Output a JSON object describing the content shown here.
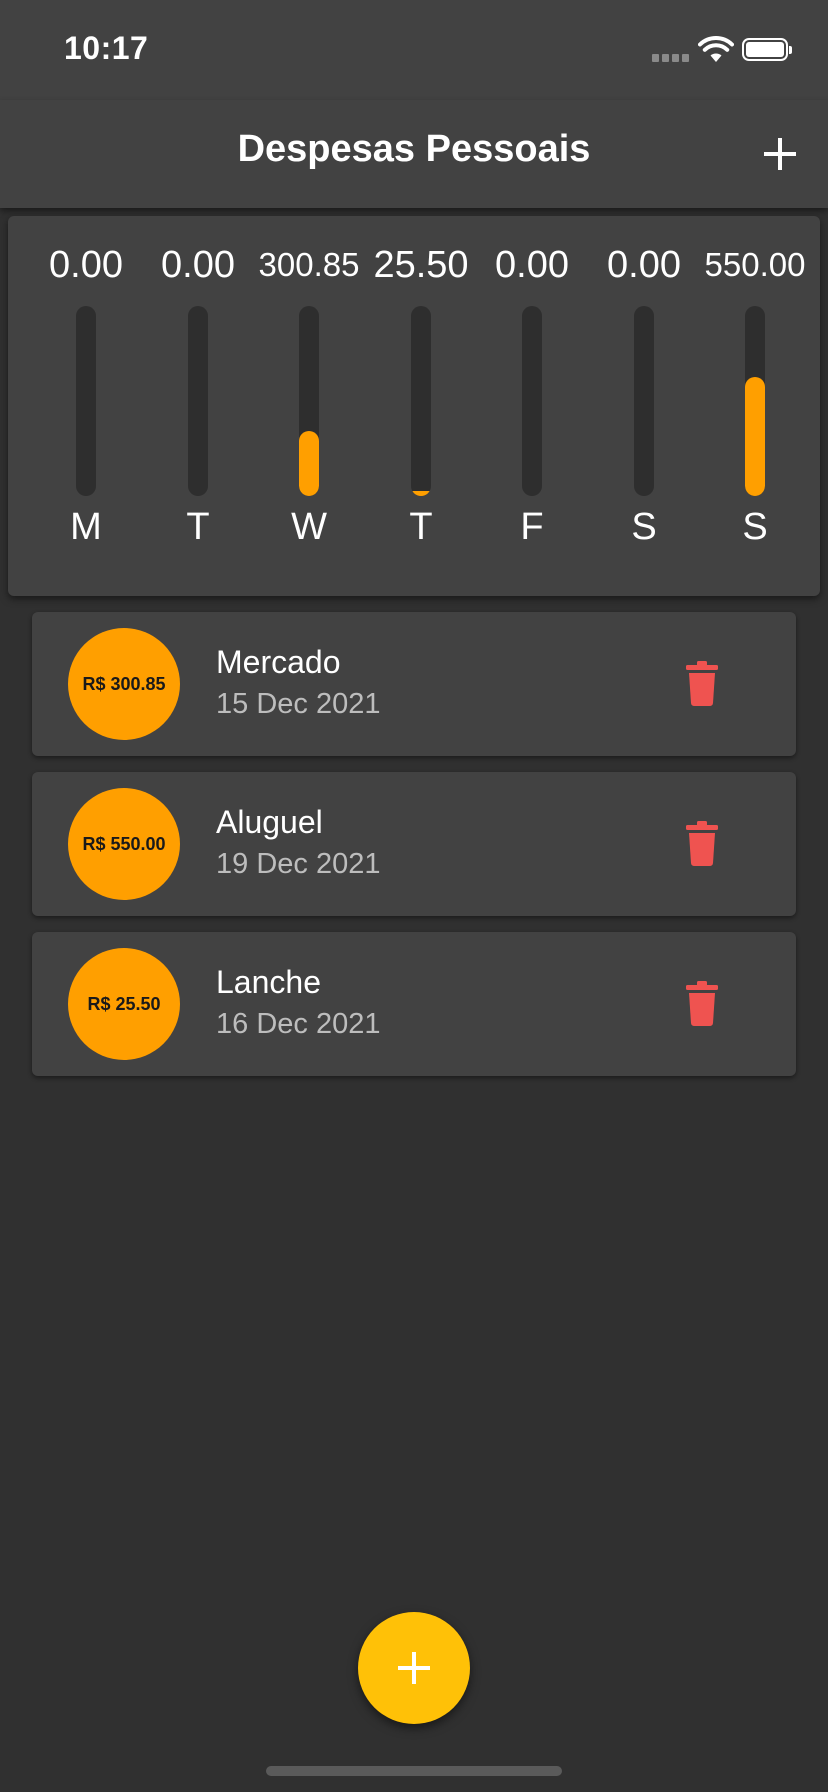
{
  "status_bar": {
    "time": "10:17"
  },
  "app_bar": {
    "title": "Despesas Pessoais",
    "add_icon": "plus-icon"
  },
  "chart": {
    "bar_color": "#ff9f00",
    "days": [
      {
        "label": "M",
        "total": "0.00",
        "fraction": 0.0
      },
      {
        "label": "T",
        "total": "0.00",
        "fraction": 0.0
      },
      {
        "label": "W",
        "total": "300.85",
        "fraction": 0.343
      },
      {
        "label": "T",
        "total": "25.50",
        "fraction": 0.029
      },
      {
        "label": "F",
        "total": "0.00",
        "fraction": 0.0
      },
      {
        "label": "S",
        "total": "0.00",
        "fraction": 0.0
      },
      {
        "label": "S",
        "total": "550.00",
        "fraction": 0.627
      }
    ]
  },
  "transactions": [
    {
      "amount": "R$ 300.85",
      "title": "Mercado",
      "date": "15 Dec 2021",
      "delete_icon": "trash-icon"
    },
    {
      "amount": "R$ 550.00",
      "title": "Aluguel",
      "date": "19 Dec 2021",
      "delete_icon": "trash-icon"
    },
    {
      "amount": "R$ 25.50",
      "title": "Lanche",
      "date": "16 Dec 2021",
      "delete_icon": "trash-icon"
    }
  ],
  "fab": {
    "icon": "plus-icon",
    "color": "#ffc107"
  },
  "colors": {
    "background": "#303030",
    "surface": "#424242",
    "accent": "#ff9f00",
    "delete": "#ef5350"
  }
}
